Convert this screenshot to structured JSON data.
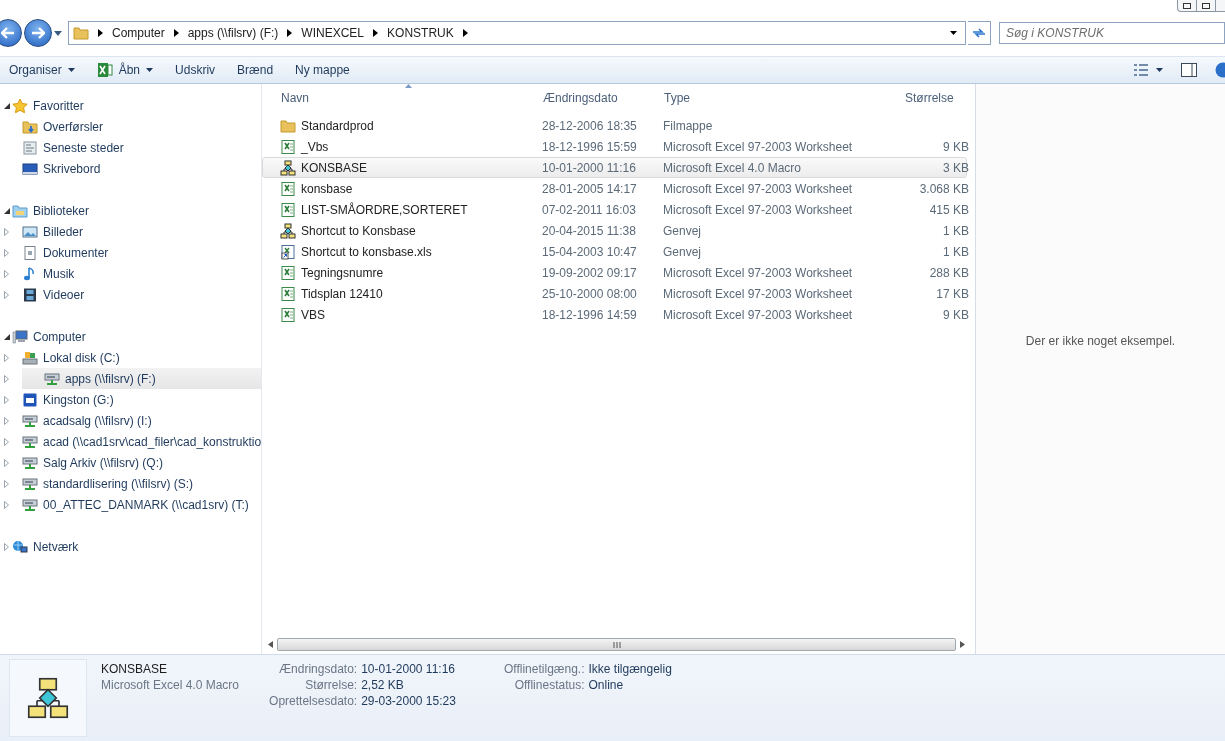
{
  "address_bar": {
    "breadcrumbs": [
      "Computer",
      "apps (\\\\filsrv) (F:)",
      "WINEXCEL",
      "KONSTRUK"
    ]
  },
  "search": {
    "placeholder": "Søg i KONSTRUK"
  },
  "toolbar": [
    {
      "label": "Organiser",
      "kind": "menu"
    },
    {
      "label": "Åbn",
      "kind": "app-menu"
    },
    {
      "label": "Udskriv",
      "kind": "button"
    },
    {
      "label": "Brænd",
      "kind": "button"
    },
    {
      "label": "Ny mappe",
      "kind": "button"
    }
  ],
  "sidebar": [
    {
      "label": "Favoritter",
      "kind": "star",
      "expanded": true,
      "children": [
        {
          "label": "Overførsler",
          "kind": "downloads",
          "selected": false
        },
        {
          "label": "Seneste steder",
          "kind": "recent",
          "selected": false
        },
        {
          "label": "Skrivebord",
          "kind": "desktop",
          "selected": false
        }
      ]
    },
    {
      "label": "Biblioteker",
      "kind": "library",
      "expanded": true,
      "children": [
        {
          "label": "Billeder",
          "kind": "pictures",
          "expanded": false,
          "selected": false
        },
        {
          "label": "Dokumenter",
          "kind": "documents",
          "expanded": false,
          "selected": false
        },
        {
          "label": "Musik",
          "kind": "music",
          "expanded": false,
          "selected": false
        },
        {
          "label": "Videoer",
          "kind": "videos",
          "expanded": false,
          "selected": false
        }
      ]
    },
    {
      "label": "Computer",
      "kind": "computer",
      "expanded": true,
      "children": [
        {
          "label": "Lokal disk (C:)",
          "kind": "disk",
          "expanded": false,
          "selected": false
        },
        {
          "label": "apps (\\\\filsrv) (F:)",
          "kind": "netdrive",
          "expanded": false,
          "selected": true
        },
        {
          "label": "Kingston (G:)",
          "kind": "sd",
          "expanded": false,
          "selected": false
        },
        {
          "label": "acadsalg (\\\\filsrv) (I:)",
          "kind": "netdrive",
          "expanded": false,
          "selected": false
        },
        {
          "label": "acad (\\\\cad1srv\\cad_filer\\cad_konstruktio",
          "kind": "netdrive",
          "expanded": false,
          "selected": false
        },
        {
          "label": "Salg Arkiv (\\\\filsrv) (Q:)",
          "kind": "netdrive",
          "expanded": false,
          "selected": false
        },
        {
          "label": "standardlisering (\\\\filsrv) (S:)",
          "kind": "netdrive",
          "expanded": false,
          "selected": false
        },
        {
          "label": "00_ATTEC_DANMARK (\\\\cad1srv) (T:)",
          "kind": "netdrive",
          "expanded": false,
          "selected": false
        }
      ]
    },
    {
      "label": "Netværk",
      "kind": "network",
      "expanded": false
    }
  ],
  "file_list": {
    "columns": [
      {
        "label": "Navn",
        "sorted": true
      },
      {
        "label": "Ændringsdato",
        "sorted": false
      },
      {
        "label": "Type",
        "sorted": false
      },
      {
        "label": "Størrelse",
        "sorted": false
      }
    ],
    "rows": [
      {
        "kind": "folder",
        "name": "Standardprod",
        "date": "28-12-2006 18:35",
        "type": "Filmappe",
        "selected": false
      },
      {
        "kind": "excel",
        "name": "_Vbs",
        "date": "18-12-1996 15:59",
        "type": "Microsoft Excel 97-2003 Worksheet",
        "size": "9 KB",
        "selected": false
      },
      {
        "kind": "macro",
        "name": "KONSBASE",
        "date": "10-01-2000 11:16",
        "type": "Microsoft Excel 4.0 Macro",
        "size": "3 KB",
        "selected": true
      },
      {
        "kind": "excel",
        "name": "konsbase",
        "date": "28-01-2005 14:17",
        "type": "Microsoft Excel 97-2003 Worksheet",
        "size": "3.068 KB",
        "selected": false
      },
      {
        "kind": "excel",
        "name": "LIST-SMÅORDRE,SORTERET",
        "date": "07-02-2011 16:03",
        "type": "Microsoft Excel 97-2003 Worksheet",
        "size": "415 KB",
        "selected": false
      },
      {
        "kind": "macro",
        "name": "Shortcut to Konsbase",
        "date": "20-04-2015 11:38",
        "type": "Genvej",
        "size": "1 KB",
        "selected": false
      },
      {
        "kind": "shortcut",
        "name": "Shortcut to konsbase.xls",
        "date": "15-04-2003 10:47",
        "type": "Genvej",
        "size": "1 KB",
        "selected": false
      },
      {
        "kind": "excel",
        "name": "Tegningsnumre",
        "date": "19-09-2002 09:17",
        "type": "Microsoft Excel 97-2003 Worksheet",
        "size": "288 KB",
        "selected": false
      },
      {
        "kind": "excel",
        "name": "Tidsplan 12410",
        "date": "25-10-2000 08:00",
        "type": "Microsoft Excel 97-2003 Worksheet",
        "size": "17 KB",
        "selected": false
      },
      {
        "kind": "excel",
        "name": "VBS",
        "date": "18-12-1996 14:59",
        "type": "Microsoft Excel 97-2003 Worksheet",
        "size": "9 KB",
        "selected": false
      }
    ]
  },
  "preview": {
    "message": "Der er ikke noget eksempel."
  },
  "details": {
    "name": "KONSBASE",
    "type": "Microsoft Excel 4.0 Macro",
    "fields_1": [
      {
        "label": "Ændringsdato:",
        "value": "10-01-2000 11:16"
      },
      {
        "label": "Størrelse:",
        "value": "2,52 KB"
      },
      {
        "label": "Oprettelsesdato:",
        "value": "29-03-2000 15:23"
      }
    ],
    "fields_2": [
      {
        "label": "Offlinetilgæng.:",
        "value": "Ikke tilgængelig"
      },
      {
        "label": "Offlinestatus:",
        "value": "Online"
      }
    ]
  }
}
